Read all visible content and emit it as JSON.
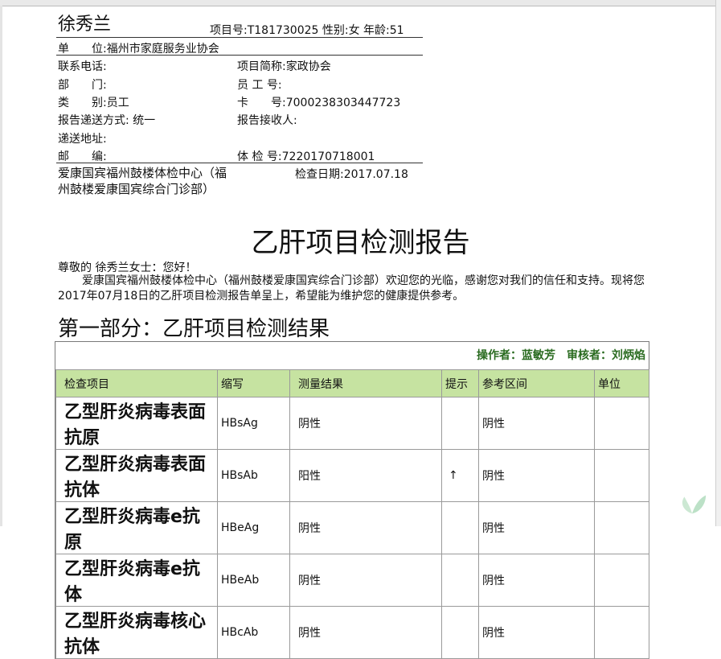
{
  "patient": {
    "name": "徐秀兰",
    "id_line": "项目号:T181730025  性别:女  年龄:51"
  },
  "info": {
    "unit_label": "单　　位:",
    "unit_value": "福州市家庭服务业协会",
    "phone_label": "联系电话:",
    "project_short_label": "项目简称:",
    "project_short_value": "家政协会",
    "dept_label": "部　　门:",
    "emp_no_label": "员 工 号:",
    "category_label": "类　　别:",
    "category_value": "员工",
    "card_label": "卡　　号:",
    "card_value": "7000238303447723",
    "delivery_method_label": "报告递送方式:",
    "delivery_method_value": "统一",
    "receiver_label": "报告接收人:",
    "address_label": "递送地址:",
    "postcode_label": "邮　　编:",
    "exam_no_label": "体 检 号:",
    "exam_no_value": "7220170718001"
  },
  "hospital": "爱康国宾福州鼓楼体检中心（福州鼓楼爱康国宾综合门诊部）",
  "exam_date": "检查日期:2017.07.18",
  "report_title": "乙肝项目检测报告",
  "greeting": "尊敬的 徐秀兰女士：您好！",
  "paragraph": "爱康国宾福州鼓楼体检中心（福州鼓楼爱康国宾综合门诊部）欢迎您的光临，感谢您对我们的信任和支持。现将您2017年07月18日的乙肝项目检测报告单呈上，希望能为维护您的健康提供参考。",
  "section_title": "第一部分：乙肝项目检测结果",
  "operators": "操作者：蓝敏芳　审核者：刘炳焰",
  "table": {
    "headers": [
      "检查项目",
      "缩写",
      "测量结果",
      "提示",
      "参考区间",
      "单位"
    ],
    "rows": [
      [
        "乙型肝炎病毒表面抗原",
        "HBsAg",
        "阴性",
        "",
        "阴性",
        ""
      ],
      [
        "乙型肝炎病毒表面抗体",
        "HBsAb",
        "阳性",
        "↑",
        "阴性",
        ""
      ],
      [
        "乙型肝炎病毒e抗原",
        "HBeAg",
        "阴性",
        "",
        "阴性",
        ""
      ],
      [
        "乙型肝炎病毒e抗体",
        "HBeAb",
        "阴性",
        "",
        "阴性",
        ""
      ],
      [
        "乙型肝炎病毒核心抗体",
        "HBcAb",
        "阴性",
        "",
        "阴性",
        ""
      ]
    ]
  },
  "colors": {
    "header_bg": "#c6e3a1",
    "operator_text": "#2a6b20"
  }
}
